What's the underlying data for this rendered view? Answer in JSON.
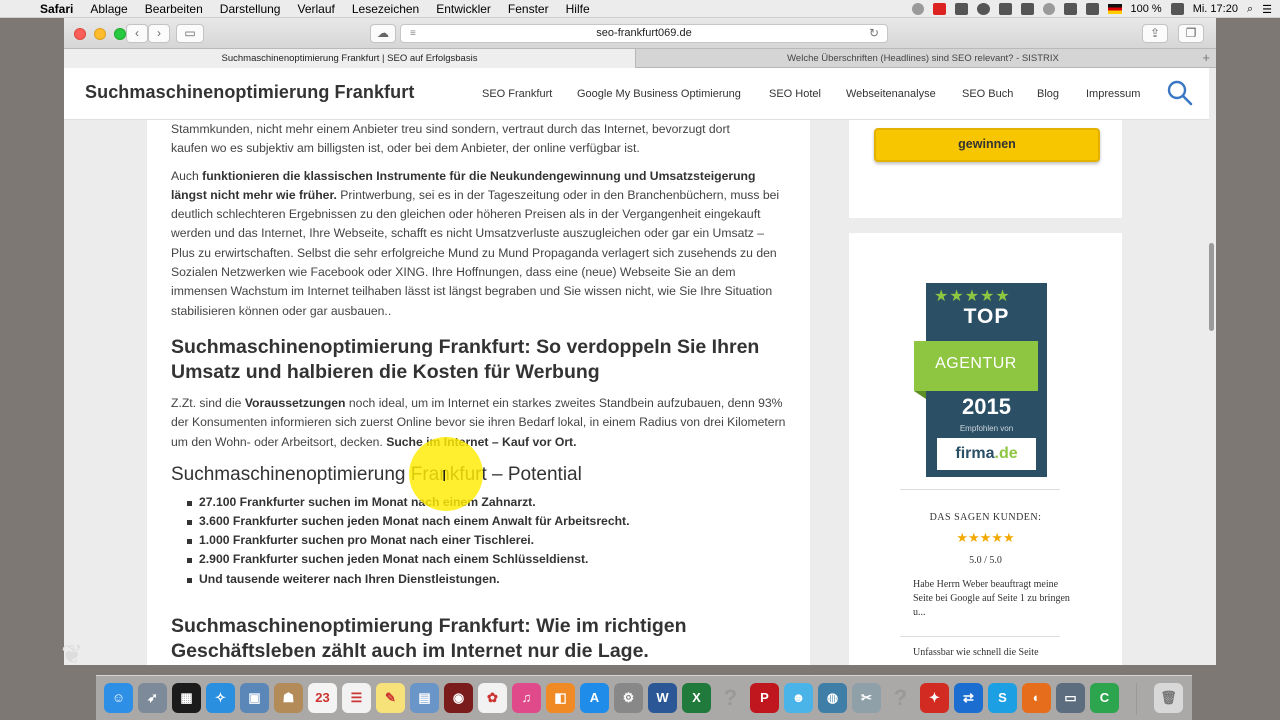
{
  "menubar": {
    "items": [
      "Safari",
      "Ablage",
      "Bearbeiten",
      "Darstellung",
      "Verlauf",
      "Lesezeichen",
      "Entwickler",
      "Fenster",
      "Hilfe"
    ],
    "battery": "100 %",
    "clock": "Mi. 17:20"
  },
  "browser": {
    "url": "seo-frankfurt069.de",
    "tabs": [
      "Suchmaschinenoptimierung Frankfurt | SEO auf Erfolgsbasis",
      "Welche Überschriften (Headlines) sind SEO relevant? - SISTRIX"
    ]
  },
  "site": {
    "title": "Suchmaschinenoptimierung Frankfurt",
    "nav": [
      "SEO Frankfurt",
      "Google My Business Optimierung",
      "SEO Hotel",
      "Webseitenanalyse",
      "SEO Buch",
      "Blog",
      "Impressum"
    ]
  },
  "article": {
    "partial_lines": [
      "Stammkunden, nicht mehr einem Anbieter treu sind sondern, vertraut durch das Internet, bevorzugt dort",
      "kaufen wo es subjektiv am billigsten ist, oder bei dem Anbieter, der online verfügbar ist."
    ],
    "p2": {
      "lead": "Auch ",
      "bold": "funktionieren die klassischen Instrumente für die Neukundengewinnung und Umsatzsteigerung längst nicht mehr wie früher.",
      "rest": " Printwerbung, sei es in der Tageszeitung oder in den Branchenbüchern, muss bei deutlich schlechteren Ergebnissen zu den gleichen oder höheren Preisen als in der Vergangenheit eingekauft werden und das Internet, Ihre Webseite, schafft es nicht Umsatzverluste auszugleichen oder gar ein Umsatz – Plus zu erwirtschaften. Selbst die sehr erfolgreiche Mund zu Mund Propaganda verlagert sich zusehends zu den Sozialen Netzwerken wie Facebook oder XING. Ihre Hoffnungen, dass eine (neue) Webseite Sie an dem immensen Wachstum im Internet teilhaben lässt ist längst begraben und Sie wissen nicht, wie Sie Ihre Situation stabilisieren können oder gar ausbauen.."
    },
    "h2_1": "Suchmaschinenoptimierung Frankfurt: So verdoppeln Sie Ihren Umsatz und halbieren die Kosten für Werbung",
    "p3": {
      "lead": "Z.Zt. sind die ",
      "bold1": "Voraussetzungen",
      "mid": " noch ideal, um im Internet ein starkes zweites Standbein aufzubauen, denn 93% der Konsumenten informieren sich zuerst Online bevor sie ihren Bedarf lokal, in einem Radius von drei Kilometern um den Wohn- oder Arbeitsort, decken. ",
      "bold2": "Suche im Internet – Kauf vor Ort."
    },
    "h3": "Suchmaschinenoptimierung Frankfurt – Potential",
    "list": [
      "27.100 Frankfurter suchen im Monat nach einem Zahnarzt.",
      "3.600 Frankfurter suchen jeden Monat nach einem Anwalt für Arbeitsrecht.",
      "1.000 Frankfurter suchen pro Monat nach einer Tischlerei.",
      "2.900 Frankfurter suchen jeden Monat nach einem Schlüsseldienst.",
      "Und tausende weiterer nach Ihren Dienstleistungen."
    ],
    "h2_2": "Suchmaschinenoptimierung Frankfurt: Wie im richtigen Geschäftsleben zählt auch im Internet nur die Lage."
  },
  "sidebar": {
    "cta_label": "gewinnen",
    "badge": {
      "stars": "★★★★★",
      "top": "TOP",
      "ribbon": "AGENTUR",
      "year": "2015",
      "small": "Empfohlen von",
      "logo_main": "firma",
      "logo_tld": ".de"
    },
    "reviews": {
      "heading": "DAS SAGEN KUNDEN:",
      "stars": "★★★★★",
      "score": "5.0 / 5.0",
      "quote1": "Habe Herrn Weber beauftragt meine Seite bei Google auf Seite 1 zu bringen u...",
      "quote2": "Unfassbar wie schnell die Seite"
    }
  },
  "dock": {
    "apps": [
      {
        "name": "finder-icon",
        "color": "#2d8fe6",
        "glyph": "☺"
      },
      {
        "name": "launchpad-icon",
        "color": "#7c8a99",
        "glyph": "➶"
      },
      {
        "name": "mission-control-icon",
        "color": "#1b1b1b",
        "glyph": "▦"
      },
      {
        "name": "safari-icon",
        "color": "#2b8fe0",
        "glyph": "✧"
      },
      {
        "name": "preview-icon",
        "color": "#5b86b8",
        "glyph": "▣"
      },
      {
        "name": "contacts-icon",
        "color": "#b38b59",
        "glyph": "☗"
      },
      {
        "name": "calendar-icon",
        "color": "#f4f4f4",
        "glyph": "23"
      },
      {
        "name": "reminders-icon",
        "color": "#f2f2f2",
        "glyph": "☰"
      },
      {
        "name": "notes-icon",
        "color": "#f7e27a",
        "glyph": "✎"
      },
      {
        "name": "image-capture-icon",
        "color": "#6a95c9",
        "glyph": "▤"
      },
      {
        "name": "photo-booth-icon",
        "color": "#7a1c1c",
        "glyph": "◉"
      },
      {
        "name": "photos-icon",
        "color": "#f2f2f2",
        "glyph": "✿"
      },
      {
        "name": "itunes-icon",
        "color": "#e04a8a",
        "glyph": "♫"
      },
      {
        "name": "ibooks-icon",
        "color": "#f08a24",
        "glyph": "◧"
      },
      {
        "name": "app-store-icon",
        "color": "#1e8ce8",
        "glyph": "A"
      },
      {
        "name": "system-preferences-icon",
        "color": "#888888",
        "glyph": "⚙"
      },
      {
        "name": "word-icon",
        "color": "#2b5797",
        "glyph": "W"
      },
      {
        "name": "excel-icon",
        "color": "#1f7a3c",
        "glyph": "X"
      },
      {
        "name": "unknown-app-icon",
        "color": "transparent",
        "glyph": "?"
      },
      {
        "name": "acrobat-icon",
        "color": "#c0161e",
        "glyph": "P"
      },
      {
        "name": "messages-icon",
        "color": "#4ab3e8",
        "glyph": "☻"
      },
      {
        "name": "globe-icon",
        "color": "#3f7fa7",
        "glyph": "◍"
      },
      {
        "name": "utility-icon",
        "color": "#8fa0a8",
        "glyph": "✂"
      },
      {
        "name": "unknown-app-2-icon",
        "color": "transparent",
        "glyph": "?"
      },
      {
        "name": "pdf-icon",
        "color": "#d12b22",
        "glyph": "✦"
      },
      {
        "name": "teamviewer-icon",
        "color": "#1c6dd0",
        "glyph": "⇄"
      },
      {
        "name": "skype-icon",
        "color": "#1ca0e3",
        "glyph": "S"
      },
      {
        "name": "firefox-icon",
        "color": "#e56d1c",
        "glyph": "◐"
      },
      {
        "name": "display-icon",
        "color": "#5c6d80",
        "glyph": "▭"
      },
      {
        "name": "camtasia-icon",
        "color": "#2da44e",
        "glyph": "C"
      }
    ]
  }
}
